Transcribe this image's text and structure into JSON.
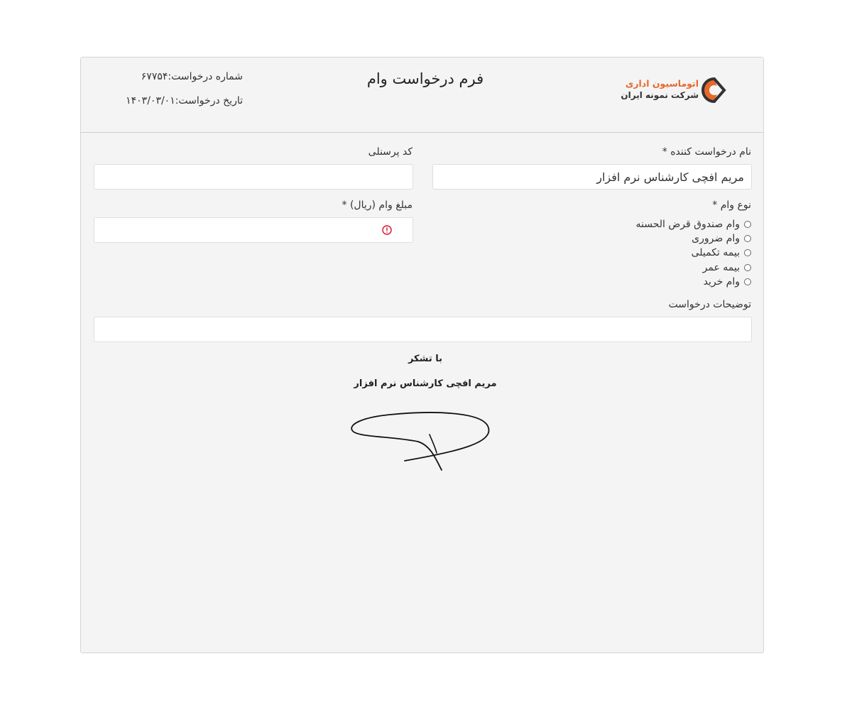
{
  "header": {
    "logo_line1": "اتوماسیون اداری",
    "logo_line2": "شرکت نمونه ایران",
    "title": "فرم درخواست وام",
    "request_number": "شماره درخواست:۶۷۷۵۴",
    "request_date": "تاریخ درخواست:۱۴۰۳/۰۳/۰۱"
  },
  "form": {
    "requester_label": "نام درخواست کننده *",
    "requester_value": "مریم افچی کارشناس نرم افزار",
    "personnel_code_label": "کد پرسنلی",
    "personnel_code_value": "",
    "loan_type_label": "نوع وام *",
    "loan_types": [
      "وام صندوق قرض الحسنه",
      "وام ضروری",
      "بیمه تکمیلی",
      "بیمه عمر",
      "وام خرید"
    ],
    "amount_label": "مبلغ وام (ریال) *",
    "amount_value": "",
    "description_label": "توضیحات درخواست",
    "description_value": ""
  },
  "footer": {
    "thanks": "با تشکر",
    "signer": "مریم افچی کارشناس نرم افزار"
  },
  "colors": {
    "logo_accent": "#e8682a",
    "error": "#d0142c",
    "panel_bg": "#f4f4f4"
  },
  "icons": {
    "logo": "company-logo-icon",
    "error": "error-circle-icon"
  }
}
